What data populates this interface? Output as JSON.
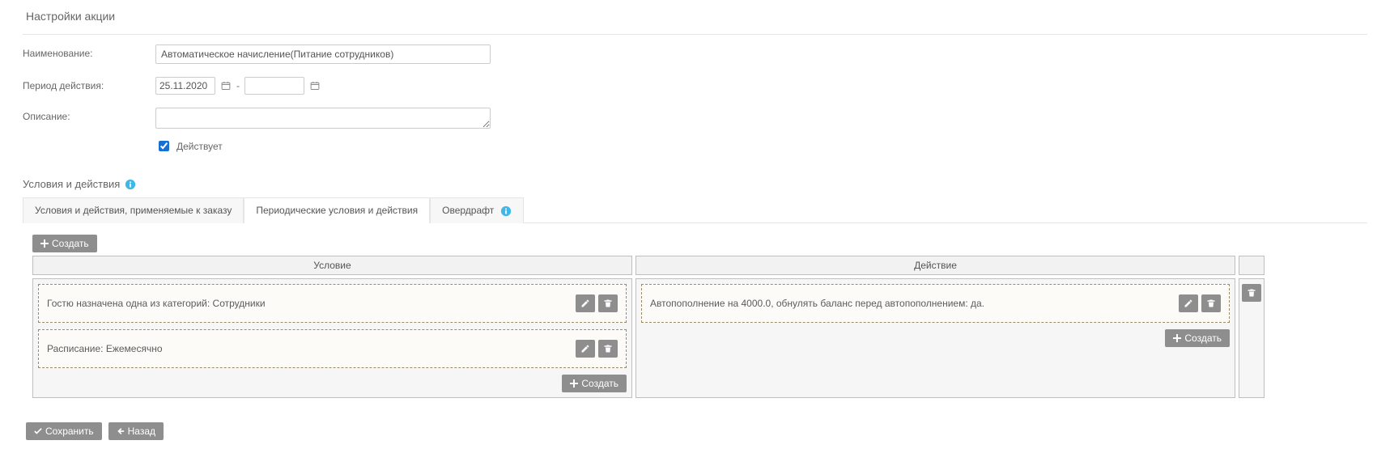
{
  "section_title": "Настройки акции",
  "form": {
    "name_label": "Наименование:",
    "name_value": "Автоматическое начисление(Питание сотрудников)",
    "period_label": "Период действия:",
    "period_from": "25.11.2020",
    "period_to": "",
    "period_sep": "-",
    "desc_label": "Описание:",
    "desc_value": "",
    "active_label": "Действует",
    "active_checked": true
  },
  "cond_section_title": "Условия и действия",
  "tabs": {
    "order": "Условия и действия, применяемые к заказу",
    "periodic": "Периодические условия и действия",
    "overdraft": "Овердрафт"
  },
  "buttons": {
    "create": "Создать",
    "save": "Сохранить",
    "back": "Назад"
  },
  "grid": {
    "col_condition": "Условие",
    "col_action": "Действие"
  },
  "conditions": [
    {
      "text": "Гостю назначена одна из категорий: Сотрудники"
    },
    {
      "text": "Расписание: Ежемесячно"
    }
  ],
  "actions": [
    {
      "text": "Автопополнение на 4000.0, обнулять баланс перед автопополнением: да."
    }
  ]
}
